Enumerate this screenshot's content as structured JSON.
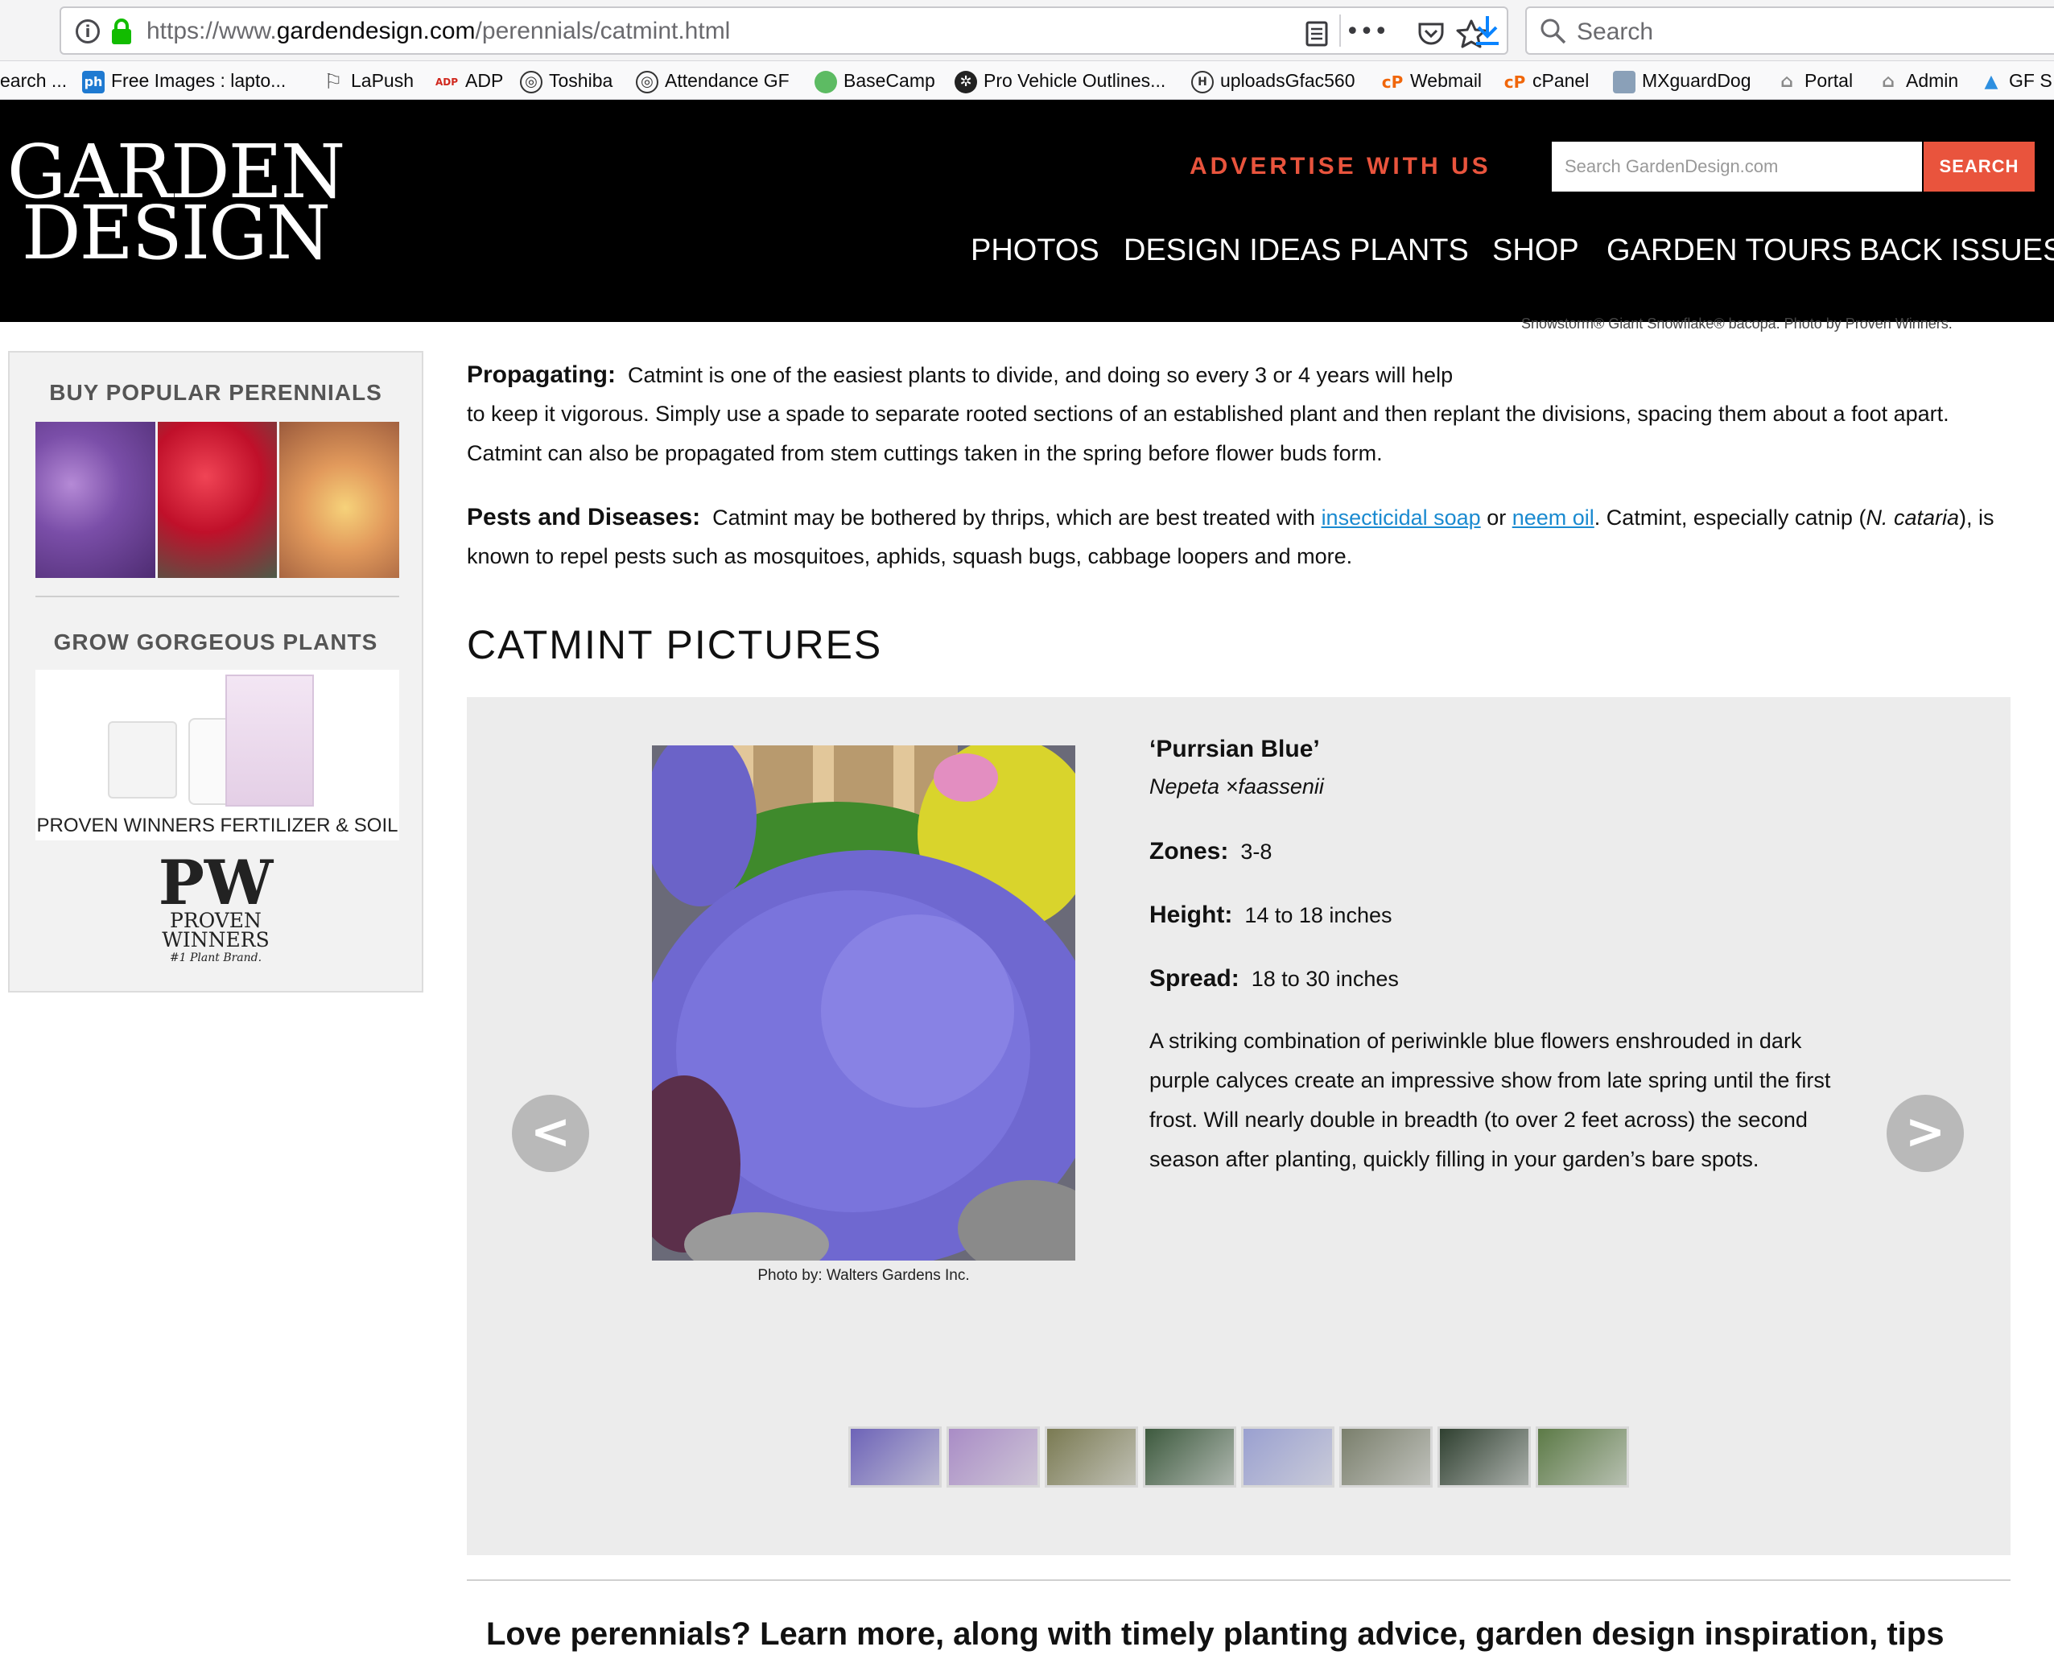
{
  "browser": {
    "url_prefix": "https://www.",
    "url_domain": "gardendesign.com",
    "url_path": "/perennials/catmint.html",
    "page_actions_glyph": "•••",
    "search_placeholder": "Search",
    "bookmarks": [
      {
        "label": "earch ...",
        "icon": "none"
      },
      {
        "label": "Free Images : lapto...",
        "icon": "ph-icon",
        "icon_text": "ph"
      },
      {
        "label": "LaPush",
        "icon": "flag-icon"
      },
      {
        "label": "ADP",
        "icon": "adp-icon",
        "icon_text": "ADP"
      },
      {
        "label": "Toshiba",
        "icon": "globe-icon"
      },
      {
        "label": "Attendance GF",
        "icon": "globe-icon"
      },
      {
        "label": "BaseCamp",
        "icon": "basecamp-icon"
      },
      {
        "label": "Pro Vehicle Outlines...",
        "icon": "gear-icon"
      },
      {
        "label": "uploadsGfac560",
        "icon": "h-icon",
        "icon_text": "H"
      },
      {
        "label": "Webmail",
        "icon": "cpanel-icon",
        "icon_text": "cP"
      },
      {
        "label": "cPanel",
        "icon": "cpanel-icon",
        "icon_text": "cP"
      },
      {
        "label": "MXguardDog",
        "icon": "dog-icon"
      },
      {
        "label": "Portal",
        "icon": "bank-icon"
      },
      {
        "label": "Admin",
        "icon": "bank-icon"
      },
      {
        "label": "GF S",
        "icon": "triangle-icon"
      }
    ]
  },
  "site": {
    "logo_line1": "GARDEN",
    "logo_line2": "DESIGN",
    "advertise": "ADVERTISE WITH US",
    "search_placeholder": "Search GardenDesign.com",
    "search_button": "SEARCH",
    "nav": [
      "PHOTOS",
      "DESIGN IDEAS",
      "PLANTS",
      "SHOP",
      "GARDEN TOURS",
      "BACK ISSUES"
    ],
    "clipped_caption": "Snowstorm® Giant Snowflake® bacopa. Photo by Proven Winners."
  },
  "sidebar": {
    "title1": "BUY POPULAR PERENNIALS",
    "title2": "GROW GORGEOUS PLANTS",
    "product_label": "PROVEN WINNERS FERTILIZER & SOIL",
    "pw_mark": "PW",
    "pw_name1": "PROVEN",
    "pw_name2": "WINNERS",
    "pw_tagline": "#1 Plant Brand."
  },
  "article": {
    "propagating_label": "Propagating:",
    "propagating_l1": "Catmint is one of the easiest plants to divide, and doing so every 3 or 4 years will help",
    "propagating_l2": "to keep it vigorous. Simply use a spade to separate rooted sections of an established plant and then replant the divisions, spacing them about a foot apart.",
    "propagating_l3": "Catmint can also be propagated from stem cuttings taken in the spring before flower buds form.",
    "pests_label": "Pests and Diseases:",
    "pests_l1a": "Catmint may be bothered by thrips, which are best treated with",
    "pests_link1": "insecticidal soap",
    "pests_or": "or",
    "pests_link2": "neem oil",
    "pests_l1b": ". Catmint, especially catnip (",
    "pests_l1c": "N. cataria",
    "pests_l1d": "), is",
    "pests_l2": "known to repel pests such as mosquitoes, aphids, squash bugs, cabbage loopers and more.",
    "section_title": "CATMINT PICTURES"
  },
  "gallery": {
    "prev": "<",
    "next": ">",
    "photo_credit": "Photo by: Walters Gardens Inc.",
    "plant_name": "‘Purrsian Blue’",
    "botanical": "Nepeta ×faassenii",
    "zones_label": "Zones:",
    "zones_value": "3-8",
    "height_label": "Height:",
    "height_value": "14 to 18 inches",
    "spread_label": "Spread:",
    "spread_value": "18 to 30 inches",
    "desc_l1": "A striking combination of periwinkle blue flowers enshrouded in dark",
    "desc_l2": "purple calyces create an impressive show from late spring until the first",
    "desc_l3": "frost. Will nearly double in breadth (to over 2 feet across) the second",
    "desc_l4": "season after planting, quickly filling in your garden’s bare spots.",
    "thumb_colors": [
      "#6d63b8",
      "#a98cc6",
      "#7a7a52",
      "#3d5a3e",
      "#9aa0d0",
      "#7a7f6c",
      "#2f4030",
      "#5c7a46"
    ]
  },
  "footer_teaser": "Love perennials? Learn more, along with timely planting advice, garden design inspiration, tips",
  "colors": {
    "accent": "#e9543d",
    "link": "#1a8ad0",
    "header_bg": "#000000",
    "gallery_bg": "#ececec"
  }
}
